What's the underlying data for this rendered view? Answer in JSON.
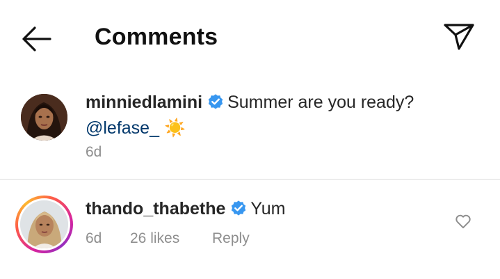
{
  "header": {
    "back_icon": "arrow-left-icon",
    "title": "Comments",
    "share_icon": "paper-plane-icon"
  },
  "caption": {
    "username": "minniedlamini",
    "verified": true,
    "text": "Summer are you ready?",
    "mention": "@lefase_",
    "emoji": "☀️",
    "age": "6d"
  },
  "comments": [
    {
      "username": "thando_thabethe",
      "verified": true,
      "text": "Yum",
      "age": "6d",
      "likes": "26 likes",
      "reply_label": "Reply",
      "like_icon": "heart-outline-icon",
      "story_ring": true
    }
  ],
  "colors": {
    "verified_blue": "#3897f0",
    "meta_gray": "#8e8e8e",
    "mention_blue": "#00376b",
    "divider": "#dbdbdb"
  }
}
